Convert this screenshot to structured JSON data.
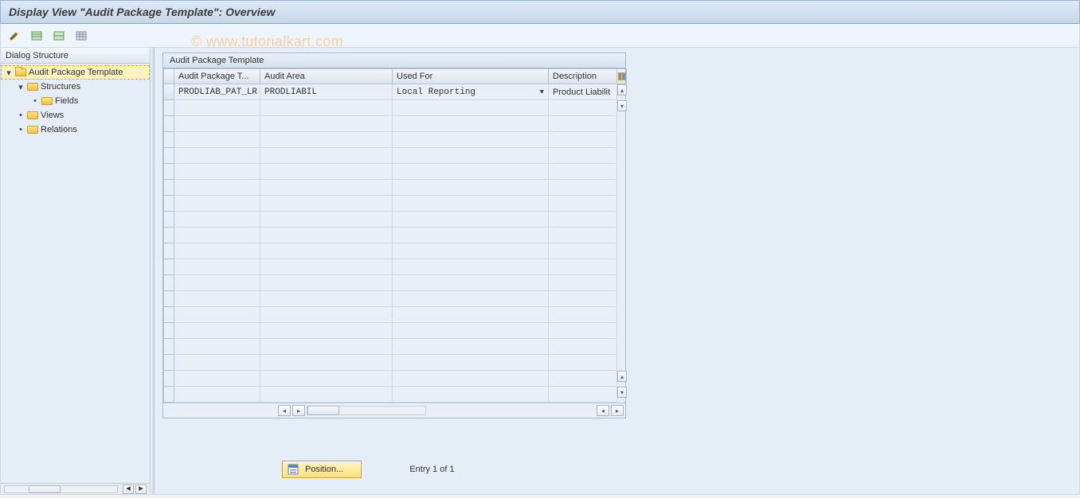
{
  "title": "Display View \"Audit Package Template\": Overview",
  "watermark": "© www.tutorialkart.com",
  "toolbar": {
    "btn_toggle": "toggle",
    "btn_expand": "expand-all",
    "btn_collapse": "collapse-all",
    "btn_print": "print"
  },
  "tree": {
    "header": "Dialog Structure",
    "nodes": {
      "root": "Audit Package Template",
      "structures": "Structures",
      "fields": "Fields",
      "views": "Views",
      "relations": "Relations"
    }
  },
  "grid": {
    "title": "Audit Package Template",
    "columns": {
      "c1": "Audit Package T...",
      "c2": "Audit Area",
      "c3": "Used For",
      "c4": "Description"
    },
    "rows": [
      {
        "template": "PRODLIAB_PAT_LR",
        "area": "PRODLIABIL",
        "used_for": "Local Reporting",
        "description": "Product Liabilit"
      }
    ]
  },
  "footer": {
    "position_btn": "Position...",
    "entry_text": "Entry 1 of 1"
  }
}
